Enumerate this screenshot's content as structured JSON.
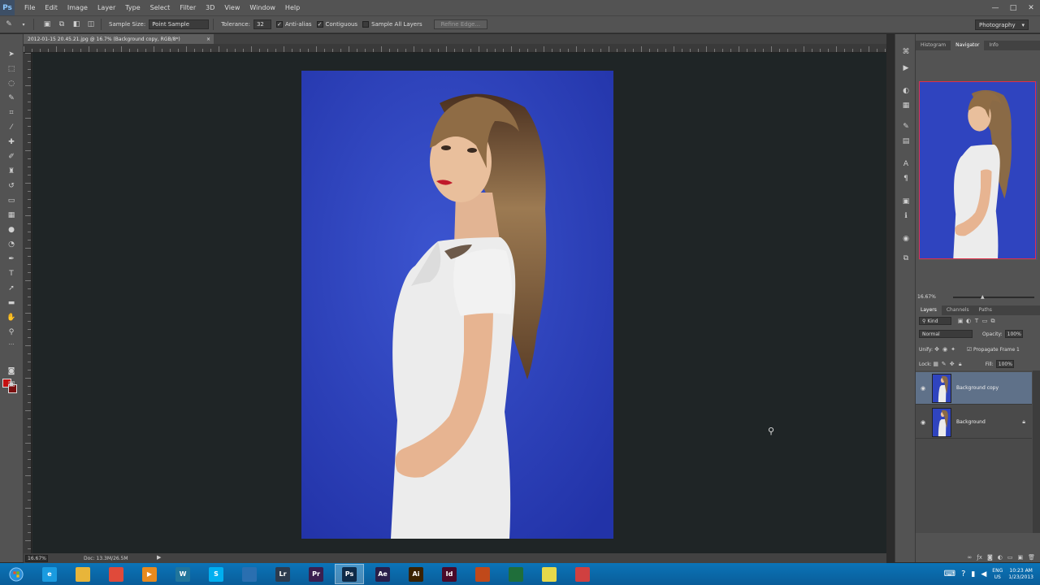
{
  "app": {
    "logo": "Ps"
  },
  "menu": [
    "File",
    "Edit",
    "Image",
    "Layer",
    "Type",
    "Select",
    "Filter",
    "3D",
    "View",
    "Window",
    "Help"
  ],
  "window_controls": [
    "—",
    "□",
    "✕"
  ],
  "options": {
    "sample_size_label": "Sample Size:",
    "sample_size_value": "Point Sample",
    "tolerance_label": "Tolerance:",
    "tolerance_value": "32",
    "anti_alias": "Anti-alias",
    "contiguous": "Contiguous",
    "sample_all_layers": "Sample All Layers",
    "refine_edge": "Refine Edge...",
    "workspace": "Photography"
  },
  "document": {
    "tab_title": "2012-01-15 20.45.21.jpg @ 16.7% (Background copy, RGB/8*)",
    "tab_close": "×"
  },
  "status": {
    "zoom": "16.67%",
    "doc_size": "Doc: 13.3M/26.5M"
  },
  "panels": {
    "top_tabs": [
      "Histogram",
      "Navigator",
      "Info"
    ],
    "navigator_zoom": "16.67%",
    "layer_tabs": [
      "Layers",
      "Channels",
      "Paths"
    ],
    "kind_label": "Kind",
    "blend_mode": "Normal",
    "opacity_label": "Opacity:",
    "opacity_value": "100%",
    "unify_label": "Unify:",
    "propagate_label": "Propagate Frame 1",
    "lock_label": "Lock:",
    "fill_label": "Fill:",
    "fill_value": "100%",
    "layers": [
      {
        "name": "Background copy",
        "selected": true
      },
      {
        "name": "Background",
        "selected": false
      }
    ]
  },
  "taskbar": {
    "apps": [
      {
        "icon": "ie-icon",
        "label": "e",
        "color": "#1a9be0"
      },
      {
        "icon": "folder-icon",
        "label": "",
        "color": "#e8b53a"
      },
      {
        "icon": "chrome-icon",
        "label": "",
        "color": "#e04a3a"
      },
      {
        "icon": "media-player-icon",
        "label": "▶",
        "color": "#e78a1e"
      },
      {
        "icon": "wordpress-icon",
        "label": "W",
        "color": "#21759b"
      },
      {
        "icon": "skype-icon",
        "label": "S",
        "color": "#00aff0"
      },
      {
        "icon": "globe-icon",
        "label": "",
        "color": "#2a6fb0"
      },
      {
        "icon": "lightroom-icon",
        "label": "Lr",
        "color": "#2d3b4e"
      },
      {
        "icon": "premiere-icon",
        "label": "Pr",
        "color": "#3b1f4f"
      },
      {
        "icon": "photoshop-icon",
        "label": "Ps",
        "color": "#0e2a47"
      },
      {
        "icon": "after-effects-icon",
        "label": "Ae",
        "color": "#2a1f4a"
      },
      {
        "icon": "illustrator-icon",
        "label": "Ai",
        "color": "#3a2200"
      },
      {
        "icon": "indesign-icon",
        "label": "Id",
        "color": "#4a0a2a"
      },
      {
        "icon": "red-app-icon",
        "label": "",
        "color": "#c0491a"
      },
      {
        "icon": "eye-app-icon",
        "label": "",
        "color": "#1f6e3a"
      },
      {
        "icon": "sticky-notes-icon",
        "label": "",
        "color": "#e6d84a"
      },
      {
        "icon": "snipping-tool-icon",
        "label": "",
        "color": "#d04040"
      }
    ],
    "tray": {
      "lang_top": "ENG",
      "lang_bottom": "US",
      "time": "10:23 AM",
      "date": "1/23/2013"
    }
  },
  "colors": {
    "foreground": "#c41010",
    "photo_background": "#2c3fb8",
    "navigator_frame": "#e0304a",
    "selected_layer": "#5f7189"
  }
}
